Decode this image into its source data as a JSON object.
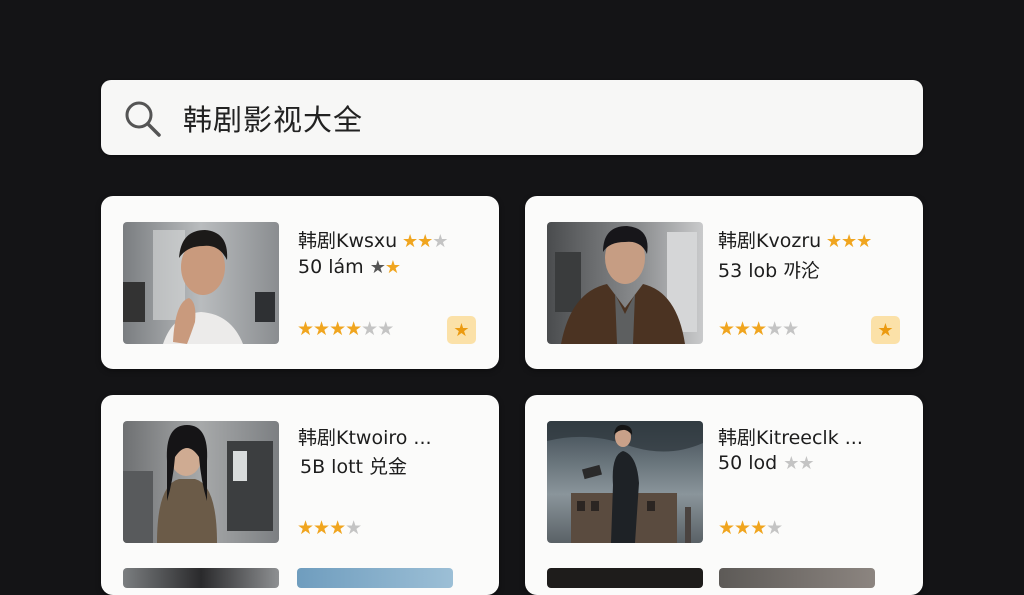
{
  "search": {
    "query": "韩剧影视大全"
  },
  "colors": {
    "background": "#141416",
    "star": "#f0a51f",
    "fav_bg": "#fbe1a8"
  },
  "cards": [
    {
      "title_prefix": "韩剧",
      "title_rest": "Kwsxu",
      "title_stars": "★★",
      "title_stars_off": "★",
      "meta_text": "50 lám ",
      "meta_star_dark": "★",
      "meta_star_on": "★",
      "rating_on": "★★★",
      "rating_half": "★",
      "rating_off": "★★",
      "fav_icon": "★",
      "thumb": "man-in-white-shirt-photo"
    },
    {
      "title_prefix": "韩剧",
      "title_rest": "Kvozru",
      "title_stars": "★★★",
      "title_stars_off": "",
      "meta_text": "53 lob 꺄",
      "meta_tail": "沦",
      "rating_on": "★★★",
      "rating_off": "★★",
      "fav_icon": "★",
      "thumb": "man-in-leather-jacket-photo"
    },
    {
      "title_prefix": "韩剧",
      "title_rest": "Ktwoiro ...",
      "meta_text": "5B lott 兑金",
      "rating_on": "★★★",
      "rating_off": "★",
      "thumb": "woman-in-coat-photo"
    },
    {
      "title_prefix": "韩剧",
      "title_rest": "Kitreeclk ...",
      "meta_text": "50 lod ",
      "meta_stars_off": "★★",
      "rating_on": "★★★",
      "rating_off": "★",
      "thumb": "man-on-rooftop-photo"
    }
  ]
}
